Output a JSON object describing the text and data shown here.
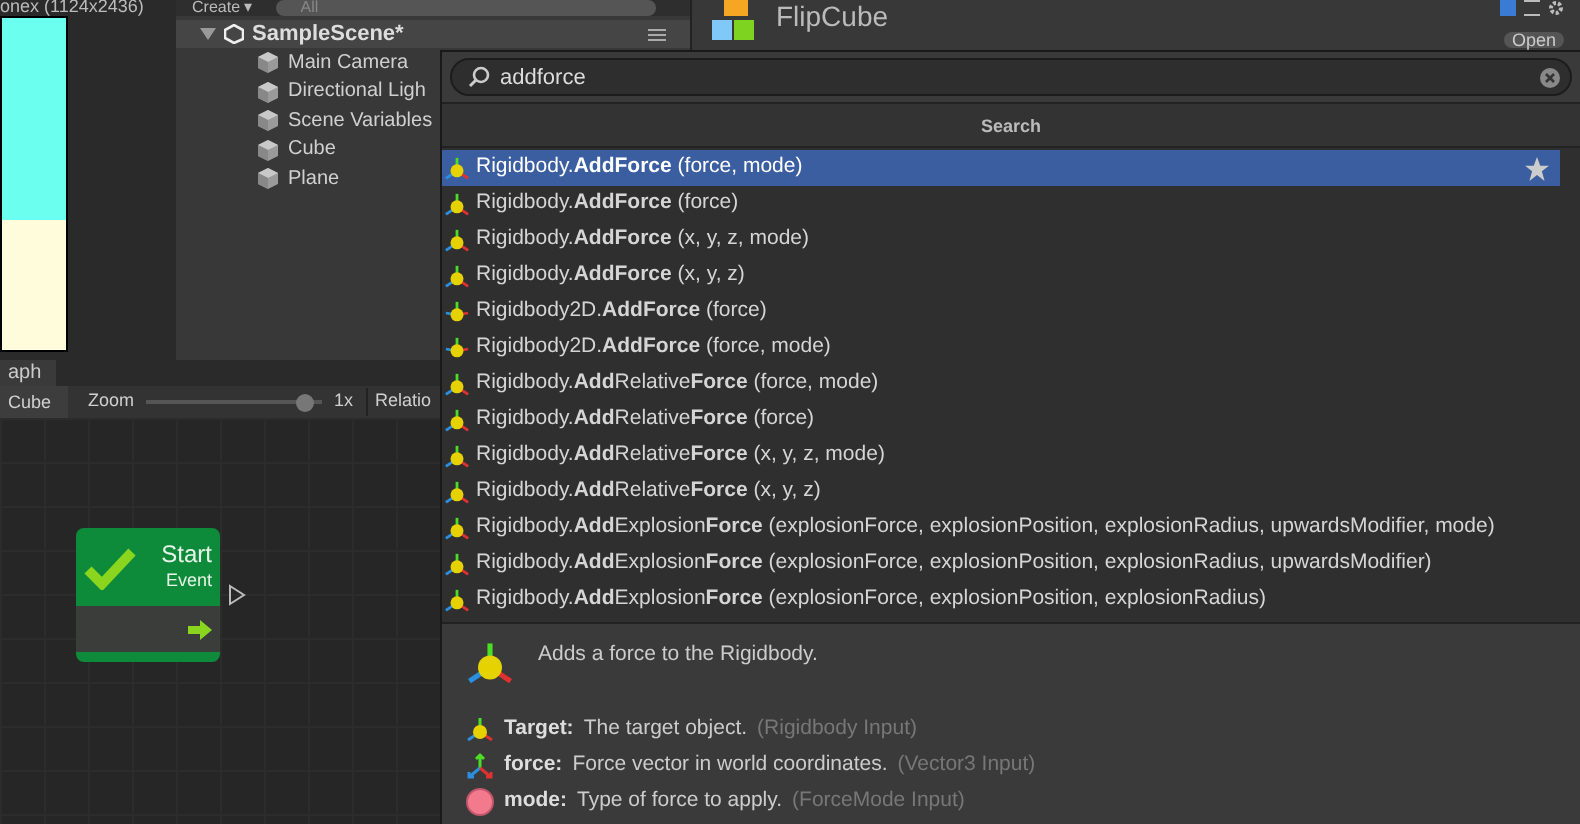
{
  "game_view": {
    "title": "onex (1124x2436)"
  },
  "hierarchy": {
    "create_label": "Create ▾",
    "search_placeholder": "All",
    "scene": {
      "name": "SampleScene*",
      "expanded": true,
      "children": [
        {
          "name": "Main Camera"
        },
        {
          "name": "Directional Ligh"
        },
        {
          "name": "Scene Variables"
        },
        {
          "name": "Cube"
        },
        {
          "name": "Plane"
        }
      ]
    }
  },
  "inspector": {
    "title": "FlipCube",
    "open_label": "Open"
  },
  "graph": {
    "tab": "aph",
    "breadcrumb": "Cube",
    "zoom_label": "Zoom",
    "zoom": {
      "level": 0.95
    },
    "zoom_reading": "1x",
    "relation_label": "Relatio",
    "node": {
      "title": "Start",
      "subtitle": "Event"
    }
  },
  "fuzzy_finder": {
    "search": {
      "value": "addforce"
    },
    "header": "Search",
    "options": [
      {
        "kind": "rigidbody",
        "label": "Rigidbody.**AddForce** (force, mode)",
        "selected": true,
        "favorite": true
      },
      {
        "kind": "rigidbody",
        "label": "Rigidbody.**AddForce** (force)",
        "selected": false,
        "favorite": false
      },
      {
        "kind": "rigidbody",
        "label": "Rigidbody.**AddForce** (x, y, z, mode)",
        "selected": false,
        "favorite": false
      },
      {
        "kind": "rigidbody",
        "label": "Rigidbody.**AddForce** (x, y, z)",
        "selected": false,
        "favorite": false
      },
      {
        "kind": "rigidbody2d",
        "label": "Rigidbody2D.**AddForce** (force)",
        "selected": false,
        "favorite": false
      },
      {
        "kind": "rigidbody2d",
        "label": "Rigidbody2D.**AddForce** (force, mode)",
        "selected": false,
        "favorite": false
      },
      {
        "kind": "rigidbody",
        "label": "Rigidbody.**Add**Relative**Force** (force, mode)",
        "selected": false,
        "favorite": false
      },
      {
        "kind": "rigidbody",
        "label": "Rigidbody.**Add**Relative**Force** (force)",
        "selected": false,
        "favorite": false
      },
      {
        "kind": "rigidbody",
        "label": "Rigidbody.**Add**Relative**Force** (x, y, z, mode)",
        "selected": false,
        "favorite": false
      },
      {
        "kind": "rigidbody",
        "label": "Rigidbody.**Add**Relative**Force** (x, y, z)",
        "selected": false,
        "favorite": false
      },
      {
        "kind": "rigidbody",
        "label": "Rigidbody.**Add**Explosion**Force** (explosionForce, explosionPosition, explosionRadius, upwardsModifier, mode)",
        "selected": false,
        "favorite": false
      },
      {
        "kind": "rigidbody",
        "label": "Rigidbody.**Add**Explosion**Force** (explosionForce, explosionPosition, explosionRadius, upwardsModifier)",
        "selected": false,
        "favorite": false
      },
      {
        "kind": "rigidbody",
        "label": "Rigidbody.**Add**Explosion**Force** (explosionForce, explosionPosition, explosionRadius)",
        "selected": false,
        "favorite": false
      }
    ],
    "description": "Adds a force to the Rigidbody.",
    "parameters": [
      {
        "kind": "rigidbody",
        "name": "Target:",
        "text": "The target object.",
        "type": "(Rigidbody Input)"
      },
      {
        "kind": "vector3",
        "name": "force:",
        "text": "Force vector in world coordinates.",
        "type": "(Vector3 Input)"
      },
      {
        "kind": "forcemode",
        "name": "mode:",
        "text": "Type of force to apply.",
        "type": "(ForceMode Input)"
      }
    ]
  }
}
